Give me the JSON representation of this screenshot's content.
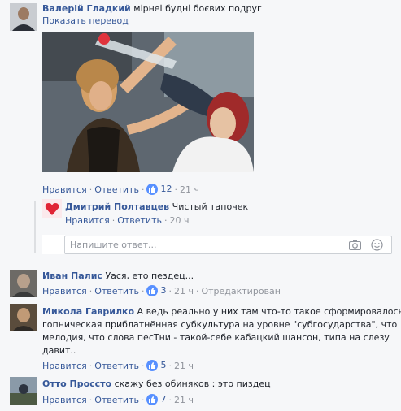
{
  "comments": [
    {
      "author": "Валерій Гладкий",
      "text": "мірнеі будні боєвих подруг",
      "translate": "Показать перевод",
      "like": "Нравится",
      "reply": "Ответить",
      "reactions": "12",
      "time": "21 ч"
    },
    {
      "author": "Дмитрий Полтавцев",
      "text": "Чистый тапочек",
      "like": "Нравится",
      "reply": "Ответить",
      "time": "20 ч"
    },
    {
      "author": "Иван Палис",
      "text": "Уася, ето пездец...",
      "like": "Нравится",
      "reply": "Ответить",
      "reactions": "3",
      "time": "21 ч",
      "edited": "Отредактирован"
    },
    {
      "author": "Микола Гаврилко",
      "line1": "А ведь реально у них там что-то такое сформировалось -",
      "line2": "гопническая приблатнённая субкультура на уровне \"субгосударства\", что",
      "line3": "мелодия, что слова песТни - такой-себе кабацкий шансон, типа на слезу",
      "line4": "давит..",
      "like": "Нравится",
      "reply": "Ответить",
      "reactions": "5",
      "time": "21 ч"
    },
    {
      "author": "Отто Проссто",
      "text": "скажу без обиняков : это пиздец",
      "like": "Нравится",
      "reply": "Ответить",
      "reactions": "7",
      "time": "21 ч"
    }
  ],
  "reply_box": {
    "placeholder": "Напишите ответ..."
  }
}
